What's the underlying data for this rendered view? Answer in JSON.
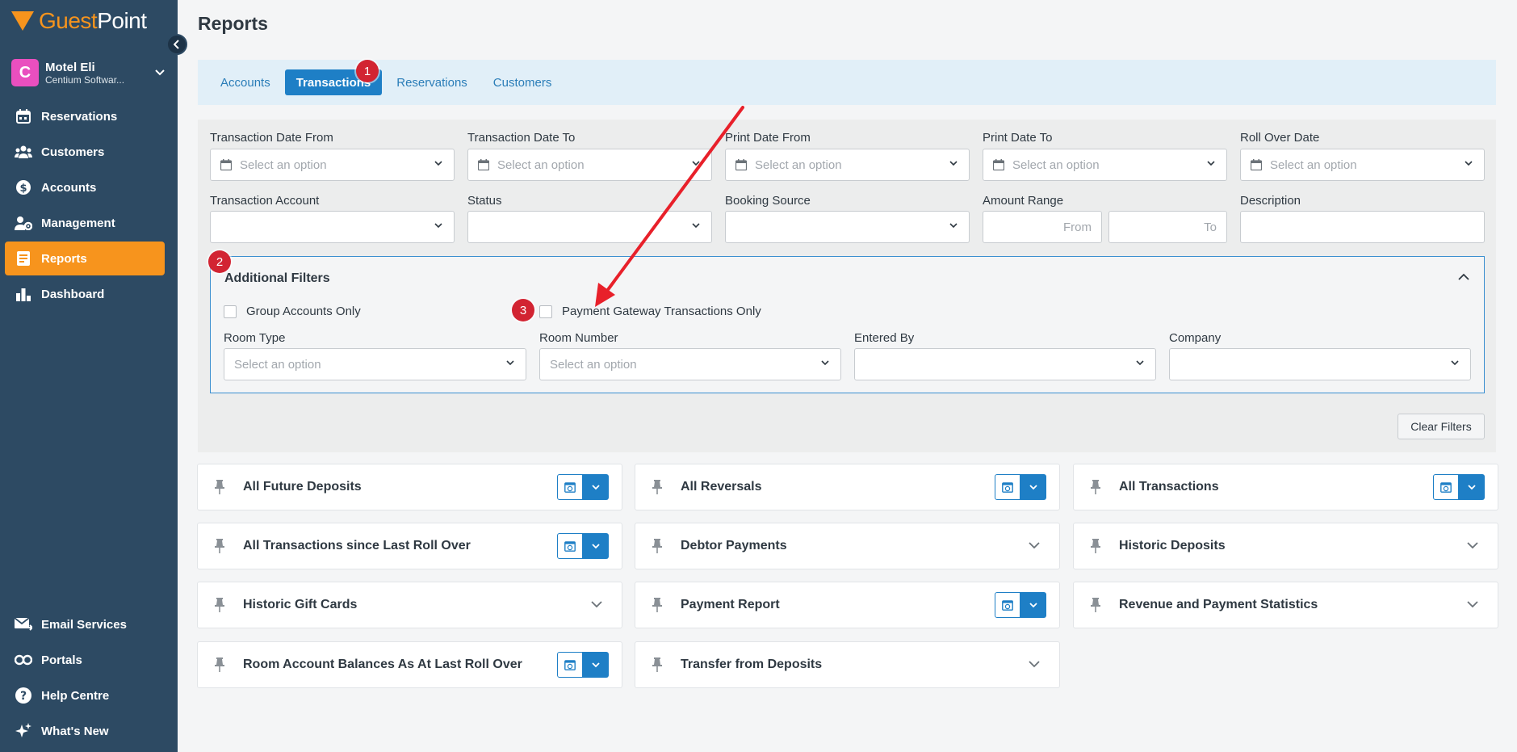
{
  "brand": {
    "name_part1": "Guest",
    "name_part2": "Point"
  },
  "property": {
    "initial": "C",
    "name": "Motel Eli",
    "company": "Centium Softwar..."
  },
  "sidebar": {
    "items": [
      {
        "label": "Reservations",
        "icon": "calendar-icon"
      },
      {
        "label": "Customers",
        "icon": "users-icon"
      },
      {
        "label": "Accounts",
        "icon": "dollar-icon"
      },
      {
        "label": "Management",
        "icon": "user-gear-icon"
      },
      {
        "label": "Reports",
        "icon": "report-icon",
        "active": true
      },
      {
        "label": "Dashboard",
        "icon": "bar-chart-icon"
      }
    ],
    "bottom_items": [
      {
        "label": "Email Services",
        "icon": "email-icon"
      },
      {
        "label": "Portals",
        "icon": "link-icon"
      },
      {
        "label": "Help Centre",
        "icon": "help-icon"
      },
      {
        "label": "What's New",
        "icon": "sparkle-icon"
      }
    ]
  },
  "page": {
    "title": "Reports"
  },
  "tabs": [
    {
      "label": "Accounts"
    },
    {
      "label": "Transactions",
      "active": true
    },
    {
      "label": "Reservations"
    },
    {
      "label": "Customers"
    }
  ],
  "annotations": {
    "one": "1",
    "two": "2",
    "three": "3"
  },
  "filters": {
    "transaction_date_from": {
      "label": "Transaction Date From",
      "placeholder": "Select an option"
    },
    "transaction_date_to": {
      "label": "Transaction Date To",
      "placeholder": "Select an option"
    },
    "print_date_from": {
      "label": "Print Date From",
      "placeholder": "Select an option"
    },
    "print_date_to": {
      "label": "Print Date To",
      "placeholder": "Select an option"
    },
    "roll_over_date": {
      "label": "Roll Over Date",
      "placeholder": "Select an option"
    },
    "transaction_account": {
      "label": "Transaction Account"
    },
    "status": {
      "label": "Status"
    },
    "booking_source": {
      "label": "Booking Source"
    },
    "amount_range": {
      "label": "Amount Range",
      "from": "From",
      "to": "To"
    },
    "description": {
      "label": "Description"
    }
  },
  "additional_filters": {
    "title": "Additional Filters",
    "group_accounts_only": "Group Accounts Only",
    "payment_gateway_only": "Payment Gateway Transactions Only",
    "room_type": {
      "label": "Room Type",
      "placeholder": "Select an option"
    },
    "room_number": {
      "label": "Room Number",
      "placeholder": "Select an option"
    },
    "entered_by": {
      "label": "Entered By"
    },
    "company": {
      "label": "Company"
    }
  },
  "clear_filters": "Clear Filters",
  "reports": [
    {
      "title": "All Future Deposits",
      "schedulable": true
    },
    {
      "title": "All Reversals",
      "schedulable": true
    },
    {
      "title": "All Transactions",
      "schedulable": true
    },
    {
      "title": "All Transactions since Last Roll Over",
      "schedulable": true
    },
    {
      "title": "Debtor Payments",
      "schedulable": false
    },
    {
      "title": "Historic Deposits",
      "schedulable": false
    },
    {
      "title": "Historic Gift Cards",
      "schedulable": false
    },
    {
      "title": "Payment Report",
      "schedulable": true
    },
    {
      "title": "Revenue and Payment Statistics",
      "schedulable": false
    },
    {
      "title": "Room Account Balances As At Last Roll Over",
      "schedulable": true
    },
    {
      "title": "Transfer from Deposits",
      "schedulable": false
    }
  ],
  "colors": {
    "sidebar": "#2d4a63",
    "accent": "#f7941d",
    "primary": "#1e7fc6",
    "annotation": "#d22432"
  }
}
